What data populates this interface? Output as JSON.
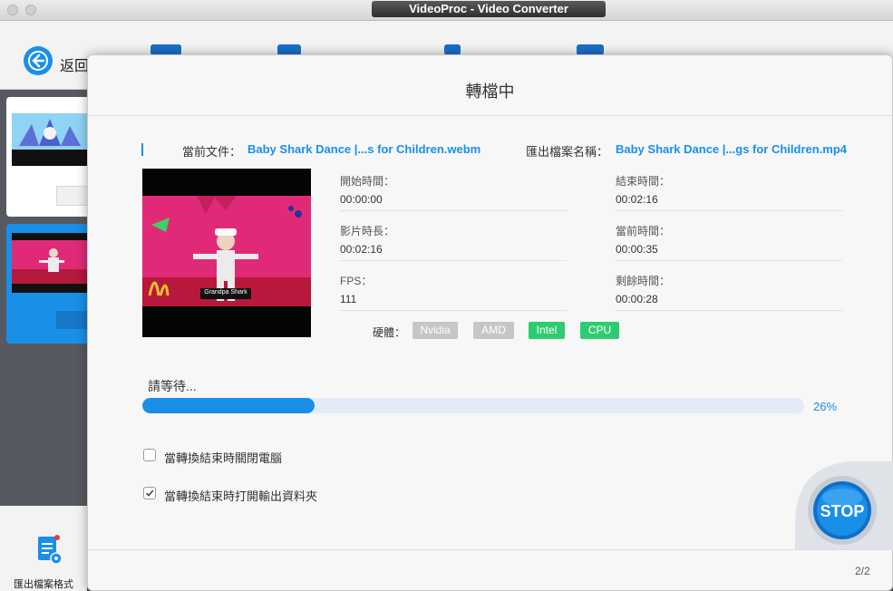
{
  "window": {
    "title": "VideoProc - Video Converter"
  },
  "toolbar": {
    "back_label": "返回"
  },
  "footer": {
    "export_label": "匯出檔案格式"
  },
  "dialog": {
    "title": "轉檔中",
    "current_file_label": "當前文件：",
    "current_file_value": "Baby Shark Dance |...s for Children.webm",
    "output_name_label": "匯出檔案名稱：",
    "output_name_value": "Baby Shark Dance |...gs for Children.mp4",
    "stats": {
      "start_time_label": "開始時間：",
      "start_time_value": "00:00:00",
      "end_time_label": "結束時間：",
      "end_time_value": "00:02:16",
      "duration_label": "影片時長：",
      "duration_value": "00:02:16",
      "current_time_label": "當前時間：",
      "current_time_value": "00:00:35",
      "fps_label": "FPS：",
      "fps_value": "111",
      "remaining_label": "剩餘時間：",
      "remaining_value": "00:00:28"
    },
    "hardware": {
      "label": "硬體：",
      "badges": [
        {
          "name": "Nvidia",
          "active": false
        },
        {
          "name": "AMD",
          "active": false
        },
        {
          "name": "Intel",
          "active": true
        },
        {
          "name": "CPU",
          "active": true
        }
      ]
    },
    "preview_caption": "Grandpa Shark",
    "status": "請等待...",
    "progress": {
      "fraction": 0.26,
      "label": "26%"
    },
    "options": [
      {
        "label": "當轉換結束時關閉電腦",
        "checked": false
      },
      {
        "label": "當轉換結束時打開輸出資料夾",
        "checked": true
      }
    ],
    "stop_label": "STOP",
    "page_count": "2/2"
  },
  "colors": {
    "accent": "#1a8fe8",
    "active_badge": "#2ecc71",
    "inactive_badge": "#c6c6c6",
    "preview_bg": "#e02a78"
  }
}
